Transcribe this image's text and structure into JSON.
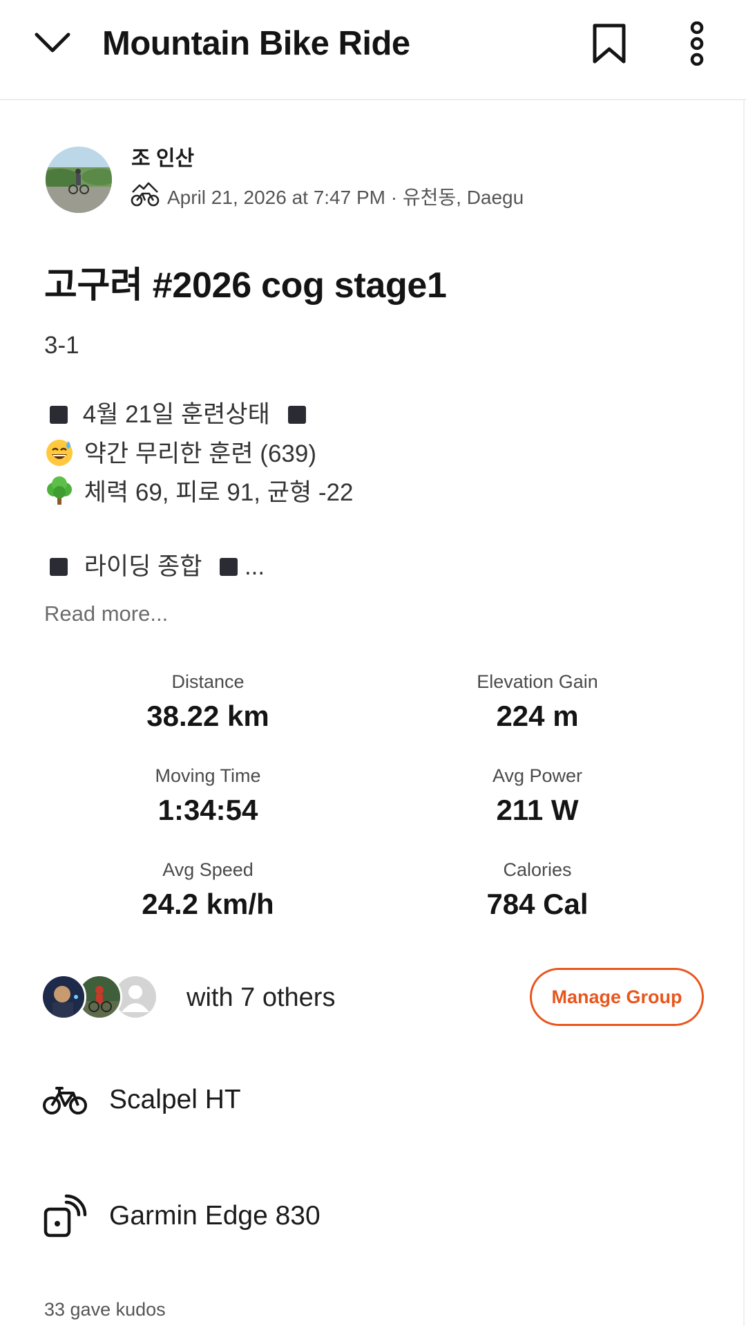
{
  "header": {
    "title": "Mountain Bike Ride",
    "icons": {
      "back": "chevron-down-icon",
      "bookmark": "bookmark-icon",
      "more": "more-vertical-icon"
    }
  },
  "athlete": {
    "name": "조 인산",
    "meta": "April 21, 2026 at 7:47 PM · 유천동, Daegu",
    "sport_icon": "mountain-bike-icon"
  },
  "activity": {
    "title": "고구려 #2026 cog stage1",
    "description": {
      "line1": "3-1",
      "line2": "4월 21일 훈련상태",
      "line3": "약간 무리한 훈련 (639)",
      "line4": "체력 69, 피로 91, 균형 -22",
      "line5": "라이딩 종합",
      "line5_suffix": "..."
    },
    "read_more": "Read more..."
  },
  "stats": [
    {
      "label": "Distance",
      "value": "38.22 km"
    },
    {
      "label": "Elevation Gain",
      "value": "224 m"
    },
    {
      "label": "Moving Time",
      "value": "1:34:54"
    },
    {
      "label": "Avg Power",
      "value": "211 W"
    },
    {
      "label": "Avg Speed",
      "value": "24.2 km/h"
    },
    {
      "label": "Calories",
      "value": "784 Cal"
    }
  ],
  "group": {
    "text": "with 7 others",
    "manage_label": "Manage Group"
  },
  "gear": {
    "bike": "Scalpel HT",
    "device": "Garmin Edge 830"
  },
  "kudos": "33 gave kudos",
  "colors": {
    "accent": "#e8561d",
    "text": "#141414",
    "muted": "#555555"
  }
}
